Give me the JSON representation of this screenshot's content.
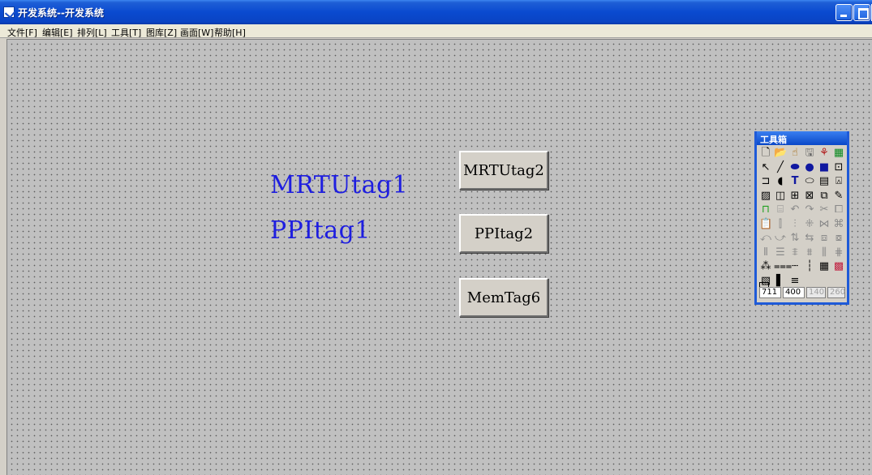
{
  "window": {
    "title": "开发系统--开发系统"
  },
  "menu": [
    {
      "label": "文件[F]"
    },
    {
      "label": "编辑[E]"
    },
    {
      "label": "排列[L]"
    },
    {
      "label": "工具[T]"
    },
    {
      "label": "图库[Z]"
    },
    {
      "label": "画面[W]"
    },
    {
      "label": "帮助[H]"
    }
  ],
  "canvas": {
    "texts": [
      {
        "label": "MRTUtag1"
      },
      {
        "label": "PPItag1"
      }
    ],
    "buttons": [
      {
        "label": "MRTUtag2"
      },
      {
        "label": "PPItag2"
      },
      {
        "label": "MemTag6"
      }
    ]
  },
  "toolbox": {
    "title": "工具箱",
    "coords": [
      "711",
      "400",
      "140",
      "260"
    ],
    "tools": [
      {
        "icon": "new-page-icon",
        "glyph": "🗋"
      },
      {
        "icon": "open-icon",
        "glyph": "📂"
      },
      {
        "icon": "wizard-icon",
        "glyph": "☝"
      },
      {
        "icon": "save-icon",
        "glyph": "🖫"
      },
      {
        "icon": "network-icon",
        "glyph": "⚘"
      },
      {
        "icon": "picture-icon",
        "glyph": "▦"
      },
      {
        "icon": "select-arrow-icon",
        "glyph": "↖"
      },
      {
        "icon": "line-icon",
        "glyph": "╱"
      },
      {
        "icon": "ellipse-line-icon",
        "glyph": "⬬"
      },
      {
        "icon": "circle-icon",
        "glyph": "●"
      },
      {
        "icon": "rectangle-icon",
        "glyph": "■"
      },
      {
        "icon": "polygon-icon",
        "glyph": "⊡"
      },
      {
        "icon": "pipe-icon",
        "glyph": "⊐"
      },
      {
        "icon": "arc-icon",
        "glyph": "◖"
      },
      {
        "icon": "text-icon",
        "glyph": "T"
      },
      {
        "icon": "rounded-rect-icon",
        "glyph": "⬭"
      },
      {
        "icon": "meter-icon",
        "glyph": "▤"
      },
      {
        "icon": "bitmap-icon",
        "glyph": "⍓"
      },
      {
        "icon": "report-icon",
        "glyph": "▨"
      },
      {
        "icon": "trend-icon",
        "glyph": "◫"
      },
      {
        "icon": "alarm-icon",
        "glyph": "⊞"
      },
      {
        "icon": "chart-icon",
        "glyph": "⊠"
      },
      {
        "icon": "group-icon",
        "glyph": "⧉"
      },
      {
        "icon": "brush-icon",
        "glyph": "✎"
      },
      {
        "icon": "gate-icon",
        "glyph": "⊓"
      },
      {
        "icon": "control-icon",
        "glyph": "⌸"
      },
      {
        "icon": "undo-icon",
        "glyph": "↶"
      },
      {
        "icon": "redo-icon",
        "glyph": "↷"
      },
      {
        "icon": "cut-icon",
        "glyph": "✂"
      },
      {
        "icon": "copy-icon",
        "glyph": "⧠"
      },
      {
        "icon": "paste-icon",
        "glyph": "📋"
      },
      {
        "icon": "align-left-icon",
        "glyph": "⫿"
      },
      {
        "icon": "align-right-icon",
        "glyph": "⫶"
      },
      {
        "icon": "align-center-icon",
        "glyph": "⁜"
      },
      {
        "icon": "align-top-icon",
        "glyph": "⋈"
      },
      {
        "icon": "align-bottom-icon",
        "glyph": "⌘"
      },
      {
        "icon": "rotate-left-icon",
        "glyph": "⤺"
      },
      {
        "icon": "rotate-right-icon",
        "glyph": "⤻"
      },
      {
        "icon": "flip-icon",
        "glyph": "⇅"
      },
      {
        "icon": "mirror-icon",
        "glyph": "⇆"
      },
      {
        "icon": "front-icon",
        "glyph": "⧈"
      },
      {
        "icon": "back-icon",
        "glyph": "⧇"
      },
      {
        "icon": "space-h-icon",
        "glyph": "⦀"
      },
      {
        "icon": "space-v-icon",
        "glyph": "☰"
      },
      {
        "icon": "same-width-icon",
        "glyph": "⩨"
      },
      {
        "icon": "same-height-icon",
        "glyph": "⩩"
      },
      {
        "icon": "distribute-icon",
        "glyph": "⫼"
      },
      {
        "icon": "grid-align-icon",
        "glyph": "⋕"
      },
      {
        "icon": "combine-icon",
        "glyph": "⁂"
      },
      {
        "icon": "split-icon",
        "glyph": "⩶"
      },
      {
        "icon": "dashed-line-icon",
        "glyph": "┄"
      },
      {
        "icon": "vertical-dashed-icon",
        "glyph": "┆"
      },
      {
        "icon": "grid-icon",
        "glyph": "▦"
      },
      {
        "icon": "palette-icon",
        "glyph": "▩"
      },
      {
        "icon": "color-fill-icon",
        "glyph": "▧"
      },
      {
        "icon": "bar-icon",
        "glyph": "▌"
      },
      {
        "icon": "lines-icon",
        "glyph": "≡"
      }
    ]
  }
}
